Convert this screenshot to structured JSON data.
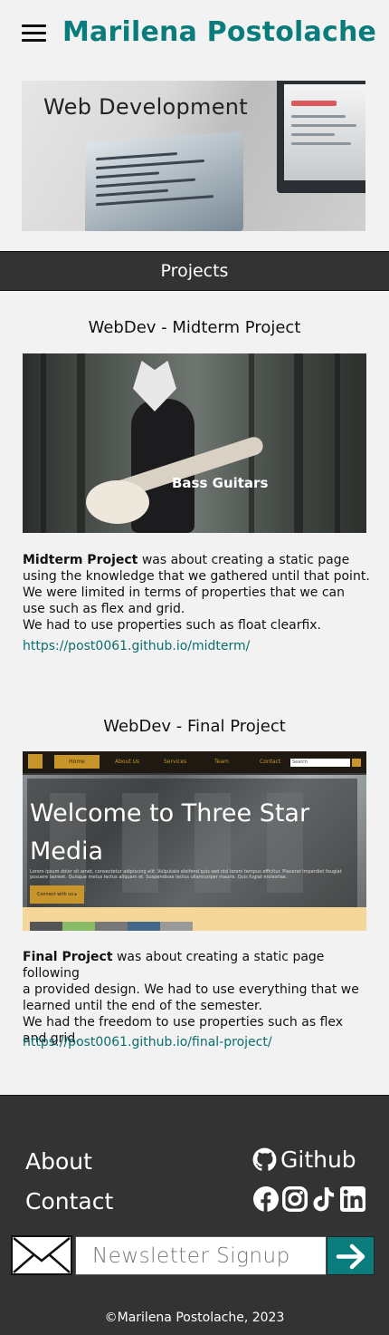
{
  "header": {
    "menu_icon": "hamburger-menu-icon",
    "title": "Marilena Postolache"
  },
  "hero": {
    "title": "Web Development"
  },
  "projects_section": {
    "heading": "Projects"
  },
  "projects": [
    {
      "title": "WebDev - Midterm Project",
      "image_caption": "Bass Guitars",
      "lead": "Midterm Project",
      "lines": [
        " was about creating a static page",
        "using the knowledge that we gathered until that point.",
        "We were limited in terms of properties that we can",
        "use such as flex and grid.",
        "We had to use properties such as float clearfix."
      ],
      "link": "https://post0061.github.io/midterm/"
    },
    {
      "title": "WebDev - Final Project",
      "image_nav": [
        "Home",
        "About Us",
        "Services",
        "Team",
        "Contact"
      ],
      "image_search": "Search",
      "image_headline": "Welcome to Three Star Media",
      "image_body": "Lorem ipsum dolor sit amet, consectetur adipiscing elit. Vulputate eleifend quis sed nisl lorem tempus efficitur. Placerat imperdiet feugiat posuere laoreet. Quisque metus lectus aliquam et. Suspendisse lectus ullamcorper mauris. Quis fugiat molestiae.",
      "image_cta": "Connect with us ▸",
      "lead": "Final Project",
      "lines": [
        " was about creating a static page following",
        "a provided design. We had to use everything that we",
        "learned until the end of the semester.",
        "We had the freedom to use properties such as flex",
        "and grid."
      ],
      "link": "https://post0061.github.io/final-project/"
    }
  ],
  "footer": {
    "about": "About",
    "contact": "Contact",
    "github": "Github",
    "social_icons": [
      "facebook-icon",
      "instagram-icon",
      "tiktok-icon",
      "linkedin-icon"
    ],
    "newsletter_placeholder": "Newsletter Signup",
    "copyright": "©Marilena Postolache, 2023"
  },
  "colors": {
    "accent": "#0b7c7c",
    "dark": "#333333",
    "background": "#f2f2f2"
  }
}
